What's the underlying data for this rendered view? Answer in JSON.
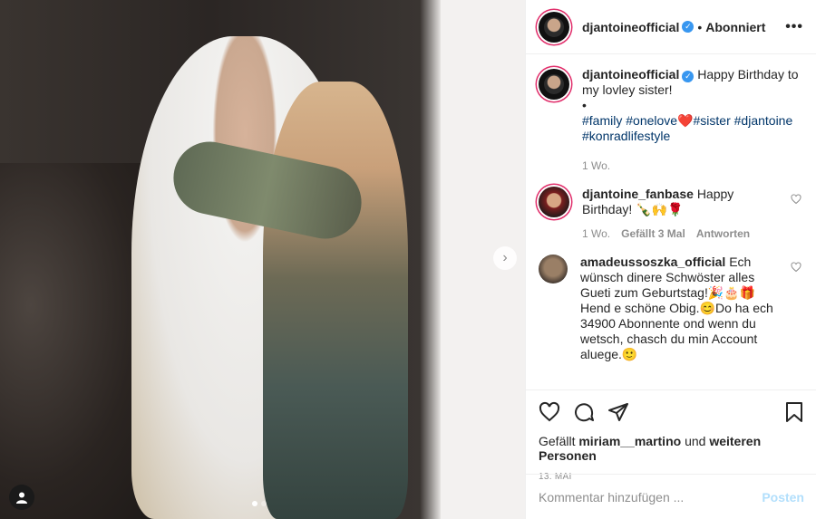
{
  "post": {
    "username": "djantoineofficial",
    "follow_state": "Abonniert",
    "more_label": "•••",
    "caption_text": "Happy Birthday to my lovley sister!",
    "caption_bullet": "•",
    "hashtags": [
      "#family",
      "#onelove",
      "#sister",
      "#djantoine",
      "#konradlifestyle"
    ],
    "caption_emoji": "❤️",
    "caption_time": "1 Wo.",
    "likes_prefix": "Gefällt",
    "likes_user": "miriam__martino",
    "likes_mid": "und",
    "likes_rest": "weiteren Personen",
    "date": "13. MAI"
  },
  "comments": [
    {
      "username": "djantoine_fanbase",
      "text": "Happy Birthday! 🍾🙌🌹",
      "time": "1 Wo.",
      "likes": "Gefällt 3 Mal",
      "reply": "Antworten"
    },
    {
      "username": "amadeussoszka_official",
      "text": "Ech wünsch dinere Schwöster alles Gueti zum Geburtstag!🎉🎂🎁 Hend e schöne Obig.😊Do ha ech 34900 Abonnente ond wenn du wetsch, chasch du min Account aluege.🙂"
    }
  ],
  "comment_input": {
    "placeholder": "Kommentar hinzufügen ...",
    "post_label": "Posten"
  },
  "carousel": {
    "current": 1,
    "total": 2,
    "next_label": "›"
  },
  "colors": {
    "link": "#003569",
    "verified": "#3897f0",
    "post_disabled": "#b2dffc",
    "muted": "#8e8e8e"
  }
}
